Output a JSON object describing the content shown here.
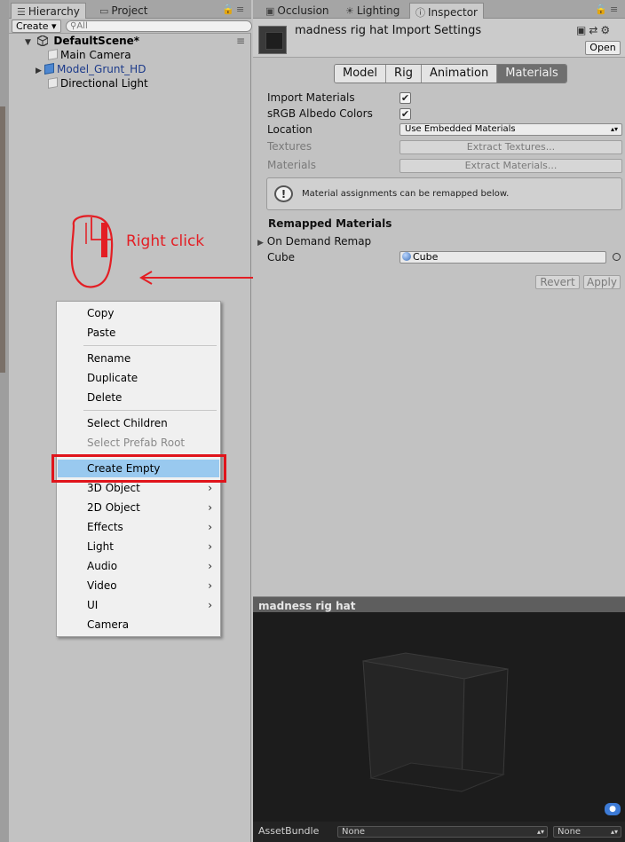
{
  "hierarchy": {
    "tab_label": "Hierarchy",
    "project_tab_label": "Project",
    "create_label": "Create",
    "search_placeholder": "All",
    "scene_name": "DefaultScene*",
    "items": [
      {
        "label": "Main Camera"
      },
      {
        "label": "Model_Grunt_HD"
      },
      {
        "label": "Directional Light"
      }
    ]
  },
  "inspector_tabs": {
    "occlusion": "Occlusion",
    "lighting": "Lighting",
    "inspector": "Inspector"
  },
  "inspector": {
    "title": "madness rig hat Import Settings",
    "open_label": "Open",
    "tabs": [
      "Model",
      "Rig",
      "Animation",
      "Materials"
    ],
    "selected_tab": "Materials",
    "fields": {
      "import_materials": {
        "label": "Import Materials",
        "checked": true
      },
      "srgb_albedo": {
        "label": "sRGB Albedo Colors",
        "checked": true
      },
      "location": {
        "label": "Location",
        "value": "Use Embedded Materials"
      },
      "textures": {
        "label": "Textures",
        "button": "Extract Textures..."
      },
      "materials": {
        "label": "Materials",
        "button": "Extract Materials..."
      }
    },
    "help_message": "Material assignments can be remapped below.",
    "remapped_title": "Remapped Materials",
    "on_demand_label": "On Demand Remap",
    "cube_label": "Cube",
    "cube_value": "Cube",
    "revert_label": "Revert",
    "apply_label": "Apply"
  },
  "preview": {
    "title": "madness rig hat",
    "assetbundle_label": "AssetBundle",
    "bundle_value": "None",
    "variant_value": "None"
  },
  "annotation": {
    "right_click_text": "Right click",
    "color": "#e31e24"
  },
  "context_menu": {
    "items": [
      {
        "label": "Copy"
      },
      {
        "label": "Paste"
      },
      {
        "label": "Rename"
      },
      {
        "label": "Duplicate"
      },
      {
        "label": "Delete"
      },
      {
        "label": "Select Children"
      },
      {
        "label": "Select Prefab Root",
        "disabled": true
      },
      {
        "label": "Create Empty",
        "highlighted": true
      },
      {
        "label": "3D Object",
        "submenu": true
      },
      {
        "label": "2D Object",
        "submenu": true
      },
      {
        "label": "Effects",
        "submenu": true
      },
      {
        "label": "Light",
        "submenu": true
      },
      {
        "label": "Audio",
        "submenu": true
      },
      {
        "label": "Video",
        "submenu": true
      },
      {
        "label": "UI",
        "submenu": true
      },
      {
        "label": "Camera"
      }
    ],
    "submenu_glyph": "›",
    "highlight_color": "#99c9ef"
  }
}
